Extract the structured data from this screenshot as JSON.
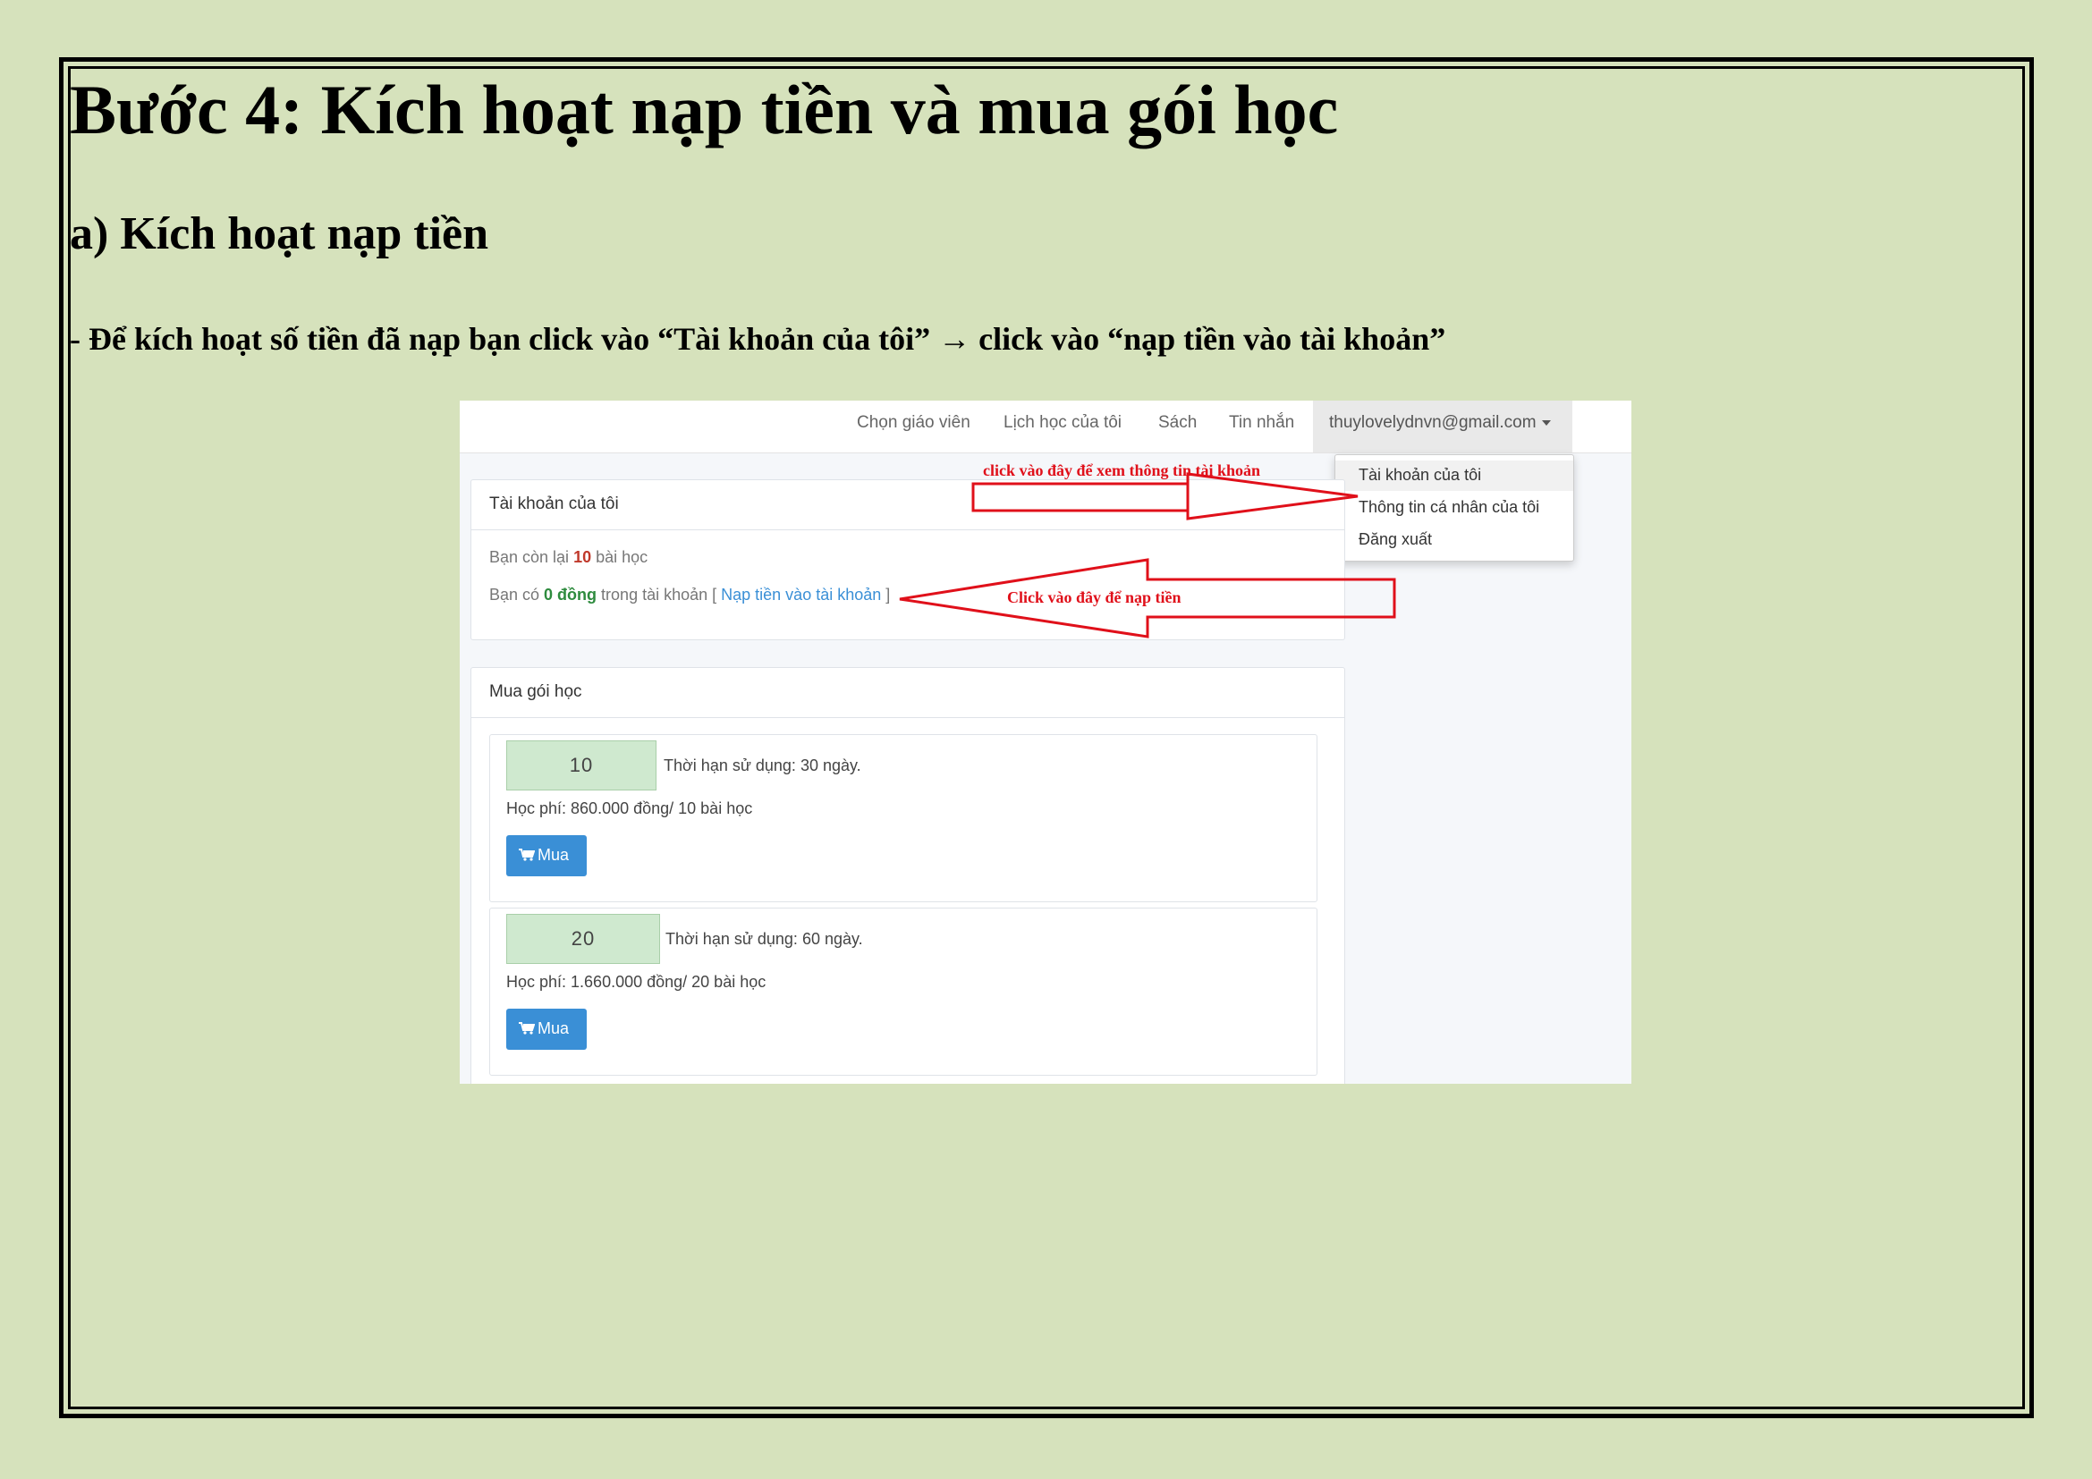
{
  "document": {
    "title": "Bước 4: Kích hoạt nạp tiền và mua gói học",
    "subtitle": "a) Kích hoạt nạp tiền",
    "instruction": "- Để kích hoạt số tiền đã nạp bạn click vào “Tài khoản của tôi” → click vào “nạp tiền vào tài khoản”"
  },
  "screenshot": {
    "nav": {
      "items": [
        "Chọn giáo viên",
        "Lịch học của tôi",
        "Sách",
        "Tin nhắn"
      ],
      "user_email": "thuylovelydnvn@gmail.com"
    },
    "dropdown": {
      "items": [
        "Tài khoản của tôi",
        "Thông tin cá nhân của tôi",
        "Đăng xuất"
      ]
    },
    "account_panel": {
      "title": "Tài khoản của tôi",
      "lessons_prefix": "Bạn còn lại ",
      "lessons_count": "10",
      "lessons_suffix": " bài học",
      "balance_prefix": "Bạn có ",
      "balance_amount": "0 đồng",
      "balance_middle": " trong tài khoản [ ",
      "topup_link": "Nạp tiền vào tài khoản",
      "balance_suffix": " ]"
    },
    "buy_panel": {
      "title": "Mua gói học",
      "packages": [
        {
          "lessons": "10",
          "term": "Thời hạn sử dụng: 30 ngày.",
          "fee": "Học phí: 860.000 đồng/ 10 bài học",
          "button": "Mua"
        },
        {
          "lessons": "20",
          "term": "Thời hạn sử dụng: 60 ngày.",
          "fee": "Học phí: 1.660.000 đồng/ 20 bài học",
          "button": "Mua"
        }
      ]
    },
    "annotations": {
      "account_hint": "click vào đây để xem thông tin tài khoản",
      "topup_hint": "Click vào đây để nạp tiền"
    },
    "colors": {
      "annotation_red": "#e0101a",
      "button_blue": "#3a8fd6",
      "package_green": "#cfe9cf"
    }
  }
}
